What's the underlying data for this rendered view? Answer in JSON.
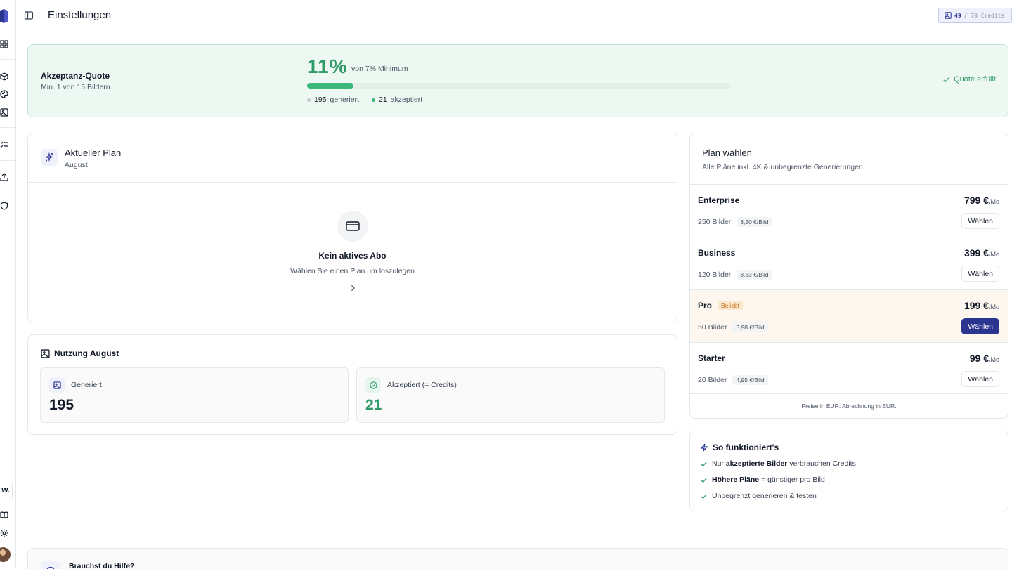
{
  "header": {
    "title": "Einstellungen",
    "credits_used": "49",
    "credits_total": "/ 70 Credits"
  },
  "quota": {
    "title": "Akzeptanz-Quote",
    "subtitle": "Min. 1 von 15 Bildern",
    "percent_label": "11%",
    "percent_value": 11,
    "minimum_label": "von 7% Minimum",
    "minimum_value": 7,
    "generated_count": "195",
    "generated_label": "generiert",
    "accepted_count": "21",
    "accepted_label": "akzeptiert",
    "status": "Quote erfüllt",
    "colors": {
      "accent": "#2e9a66",
      "bar": "#3bb97a",
      "generated_dot": "#c4c8cf"
    }
  },
  "current_plan": {
    "title": "Aktueller Plan",
    "month": "August",
    "empty_title": "Kein aktives Abo",
    "empty_subtitle": "Wählen Sie einen Plan um loszulegen"
  },
  "usage": {
    "title": "Nutzung August",
    "generated_label": "Generiert",
    "generated_value": "195",
    "accepted_label": "Akzeptiert (= Credits)",
    "accepted_value": "21"
  },
  "plans": {
    "title": "Plan wählen",
    "subtitle": "Alle Pläne inkl. 4K & unbegrenzte Generierungen",
    "unit": "/Mo",
    "items": [
      {
        "name": "Enterprise",
        "badge": "",
        "price": "799 €",
        "images": "250 Bilder",
        "per_image": "3,20 €/Bild",
        "button": "Wählen",
        "highlight": false
      },
      {
        "name": "Business",
        "badge": "",
        "price": "399 €",
        "images": "120 Bilder",
        "per_image": "3,33 €/Bild",
        "button": "Wählen",
        "highlight": false
      },
      {
        "name": "Pro",
        "badge": "Beliebt",
        "price": "199 €",
        "images": "50 Bilder",
        "per_image": "3,98 €/Bild",
        "button": "Wählen",
        "highlight": true
      },
      {
        "name": "Starter",
        "badge": "",
        "price": "99 €",
        "images": "20 Bilder",
        "per_image": "4,95 €/Bild",
        "button": "Wählen",
        "highlight": false
      }
    ],
    "footer": "Preise in EUR. Abrechnung in EUR."
  },
  "how": {
    "title": "So funktioniert's",
    "items": [
      {
        "pre": "Nur ",
        "bold": "akzeptierte Bilder",
        "post": " verbrauchen Credits"
      },
      {
        "pre": "",
        "bold": "Höhere Pläne",
        "post": " = günstiger pro Bild"
      },
      {
        "pre": "",
        "bold": "",
        "post": "Unbegrenzt generieren & testen"
      }
    ]
  },
  "help": {
    "title": "Brauchst du Hilfe?"
  },
  "sidebar": {
    "workspace_initial": "W."
  },
  "icons": [
    "logo",
    "dashboard-icon",
    "box-icon",
    "palette-icon",
    "image-icon",
    "checklist-icon",
    "upload-icon",
    "shield-icon",
    "book-icon",
    "gear-icon",
    "sidebar-toggle-icon",
    "sparkles-icon",
    "credit-card-icon",
    "chevron-right-icon",
    "check-icon",
    "zap-icon",
    "help-icon"
  ]
}
